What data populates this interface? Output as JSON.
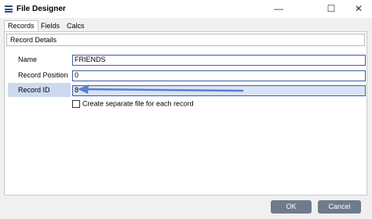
{
  "window": {
    "title": "File Designer"
  },
  "window_controls": {
    "minimize": "—",
    "maximize": "☐",
    "close": "✕"
  },
  "tabs": [
    {
      "label": "Records",
      "active": true
    },
    {
      "label": "Fields",
      "active": false
    },
    {
      "label": "Calcs",
      "active": false
    }
  ],
  "section": {
    "title": "Record Details"
  },
  "form": {
    "name": {
      "label": "Name",
      "value": "FRIENDS"
    },
    "record_position": {
      "label": "Record Position",
      "value": "0"
    },
    "record_id": {
      "label": "Record ID",
      "value": "8"
    },
    "separate_file": {
      "label": "Create separate file for each record",
      "checked": false
    }
  },
  "buttons": {
    "ok": "OK",
    "cancel": "Cancel"
  },
  "colors": {
    "accent": "#3a5ea8",
    "arrow": "#5b7fd0",
    "button": "#6f7b8c",
    "selected_row": "#cdd9ee"
  }
}
